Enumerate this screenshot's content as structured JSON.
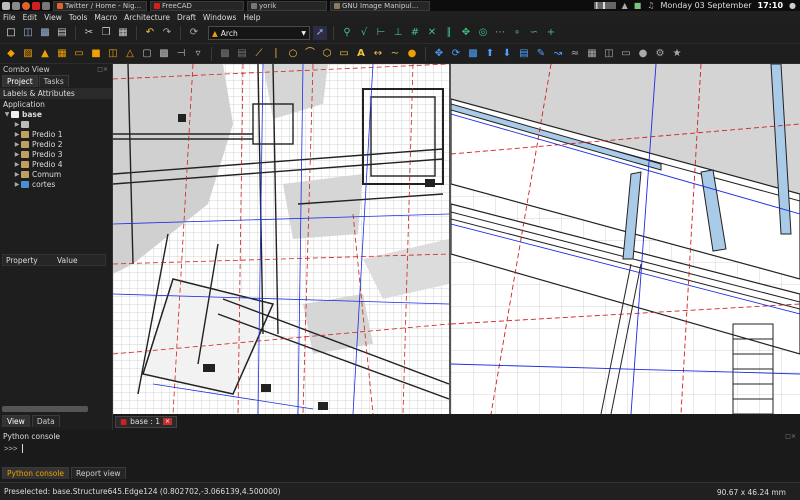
{
  "taskbar": {
    "tasks": [
      {
        "label": "Twitter / Home - Nig..."
      },
      {
        "label": "FreeCAD"
      },
      {
        "label": "yorik"
      },
      {
        "label": "GNU Image Manipul..."
      }
    ],
    "clock_date": "Monday 03 September",
    "clock_time": "17:10"
  },
  "menubar": {
    "items": [
      "File",
      "Edit",
      "View",
      "Tools",
      "Macro",
      "Architecture",
      "Draft",
      "Windows",
      "Help"
    ]
  },
  "toolbar": {
    "workbench": "Arch"
  },
  "combo_view": {
    "title": "Combo View",
    "tabs": [
      "Project",
      "Tasks"
    ],
    "labels_header": "Labels & Attributes",
    "application_label": "Application",
    "tree": [
      {
        "label": "base",
        "level": 0,
        "expanded": true
      },
      {
        "label": "",
        "level": 1
      },
      {
        "label": "Predio 1",
        "level": 1
      },
      {
        "label": "Predio 2",
        "level": 1
      },
      {
        "label": "Predio 3",
        "level": 1
      },
      {
        "label": "Predio 4",
        "level": 1
      },
      {
        "label": "Comum",
        "level": 1
      },
      {
        "label": "cortes",
        "level": 1
      }
    ],
    "property_columns": [
      "Property",
      "Value"
    ],
    "view_tabs": [
      "View",
      "Data"
    ]
  },
  "document_tab": "base : 1",
  "console": {
    "title": "Python console",
    "prompt": ">>>",
    "tabs": [
      "Python console",
      "Report view"
    ]
  },
  "status": {
    "message": "Preselected: base.Structure645.Edge124 (0.802702,-3.066139,4.500000)",
    "dimensions": "90.67 x 46.24 mm"
  },
  "colors": {
    "accent": "#f0a000",
    "background": "#1e1e1e",
    "viewport": "#ffffff"
  }
}
